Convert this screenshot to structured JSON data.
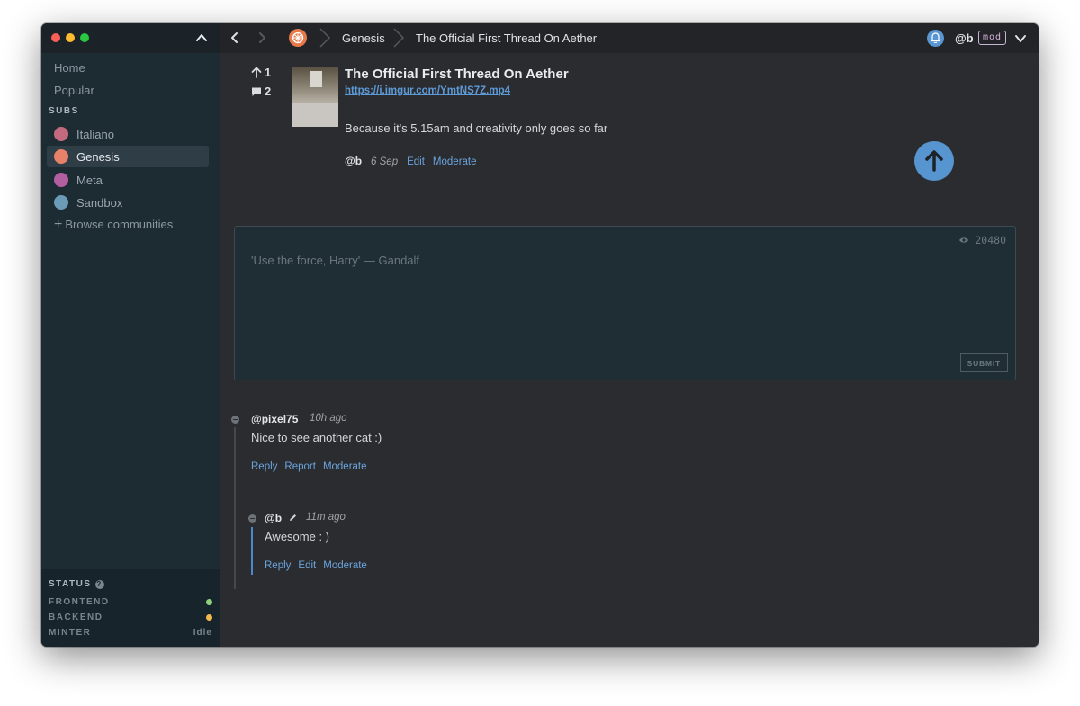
{
  "sidebar": {
    "nav": [
      {
        "label": "Home"
      },
      {
        "label": "Popular"
      }
    ],
    "subs_header": "SUBS",
    "subs": [
      {
        "label": "Italiano",
        "color": "#c36a7e"
      },
      {
        "label": "Genesis",
        "color": "#e8816a"
      },
      {
        "label": "Meta",
        "color": "#b15fa0"
      },
      {
        "label": "Sandbox",
        "color": "#6b9bb7"
      }
    ],
    "browse_label": "Browse communities",
    "status": {
      "title": "STATUS",
      "frontend_label": "FRONTEND",
      "frontend_color": "#8fd17a",
      "backend_label": "BACKEND",
      "backend_color": "#f3b94d",
      "minter_label": "MINTER",
      "minter_value": "Idle"
    }
  },
  "topbar": {
    "breadcrumb_community": "Genesis",
    "breadcrumb_thread": "The Official First Thread On Aether",
    "user_handle": "@b",
    "mod_badge": "mod"
  },
  "post": {
    "upvotes": "1",
    "comments": "2",
    "title": "The Official First Thread On Aether",
    "link": "https://i.imgur.com/YmtNS7Z.mp4",
    "body": "Because it's 5.15am and creativity only goes so far",
    "author": "@b",
    "time": "6 Sep",
    "edit_label": "Edit",
    "moderate_label": "Moderate"
  },
  "composer": {
    "char_count": "20480",
    "placeholder": "'Use the force, Harry' — Gandalf",
    "submit_label": "SUBMIT"
  },
  "comments": [
    {
      "author": "@pixel75",
      "time": "10h ago",
      "body": "Nice to see another cat :)",
      "actions": [
        "Reply",
        "Report",
        "Moderate"
      ]
    },
    {
      "author": "@b",
      "time": "11m ago",
      "body": "Awesome : )",
      "actions": [
        "Reply",
        "Edit",
        "Moderate"
      ]
    }
  ]
}
